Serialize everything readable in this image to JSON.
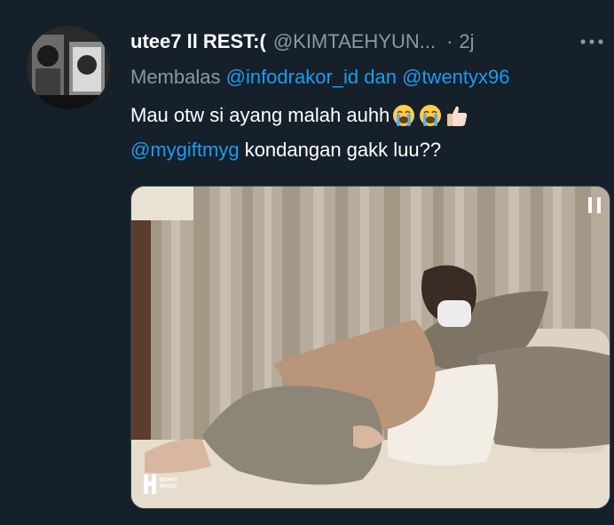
{
  "tweet": {
    "display_name": "utee7 ll REST:(",
    "handle": "@KIMTAEHYUN...",
    "separator": "·",
    "time": "2j",
    "reply": {
      "prefix": "Membalas",
      "mention_1": "@infodrakor_id",
      "joiner": "dan",
      "mention_2": "@twentyx96"
    },
    "text_line_1": "Mau otw si ayang malah auhh",
    "text_line_2_mention": "@mygiftmyg",
    "text_line_2_rest": " kondangan gakk luu??",
    "emojis": [
      "loudly-crying-face",
      "loudly-crying-face",
      "thumbs-up-light-skin"
    ]
  },
  "media": {
    "watermark_line_1": "BIGHIT",
    "watermark_line_2": "MUSIC"
  },
  "colors": {
    "background": "#15202b",
    "secondary_text": "#8b98a5",
    "link": "#1d9bf0"
  }
}
